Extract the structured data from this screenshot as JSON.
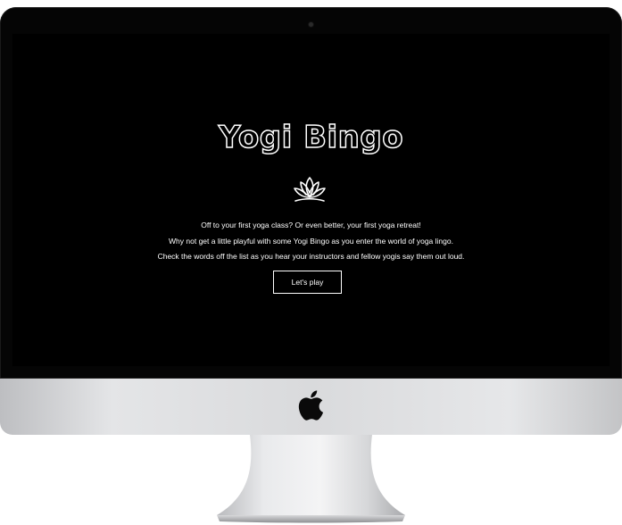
{
  "site": {
    "title": "Yogi Bingo",
    "icon": "lotus-icon",
    "lines": [
      "Off to your first yoga class? Or even better, your first yoga retreat!",
      "Why not get a little playful with some Yogi Bingo as you enter the world of yoga lingo.",
      "Check the words off the list as you hear your instructors and fellow yogis say them out loud."
    ],
    "button_label": "Let's play"
  },
  "colors": {
    "screen_background": "#000000",
    "text": "#ffffff",
    "bezel": "#050505",
    "chin": "#d9dadc"
  },
  "device": {
    "logo": "apple-icon"
  }
}
